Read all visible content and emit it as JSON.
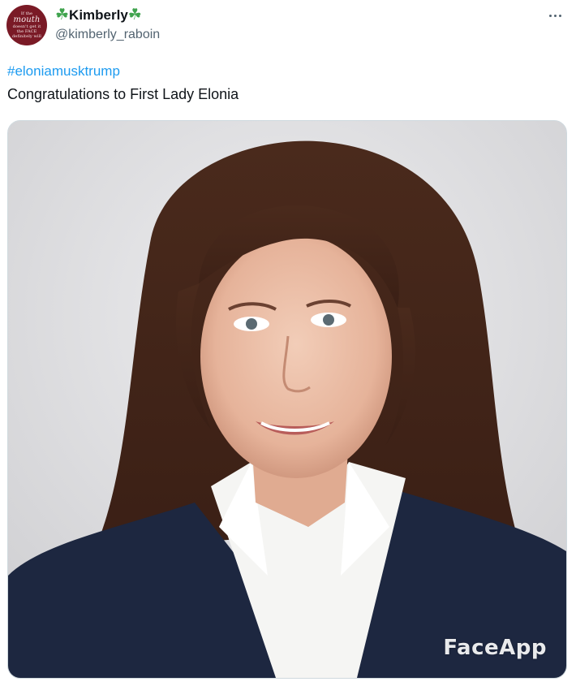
{
  "author": {
    "display_name": "Kimberly",
    "name_emoji": "☘",
    "handle": "@kimberly_raboin",
    "avatar_text": [
      "If the",
      "mouth",
      "doesn't get it",
      "the FACE",
      "definitely will"
    ]
  },
  "tweet": {
    "hashtag": "#eloniamusktrump",
    "text": "Congratulations to First Lady Elonia"
  },
  "media": {
    "watermark": "FaceApp",
    "description_icon": "portrait-photo"
  },
  "colors": {
    "link": "#1d9bf0",
    "secondary_text": "#536471",
    "clover": "#3fa34d",
    "avatar_bg": "#7a1a26"
  },
  "icons": {
    "more": "more-options-icon",
    "clover": "four-leaf-clover-icon"
  }
}
